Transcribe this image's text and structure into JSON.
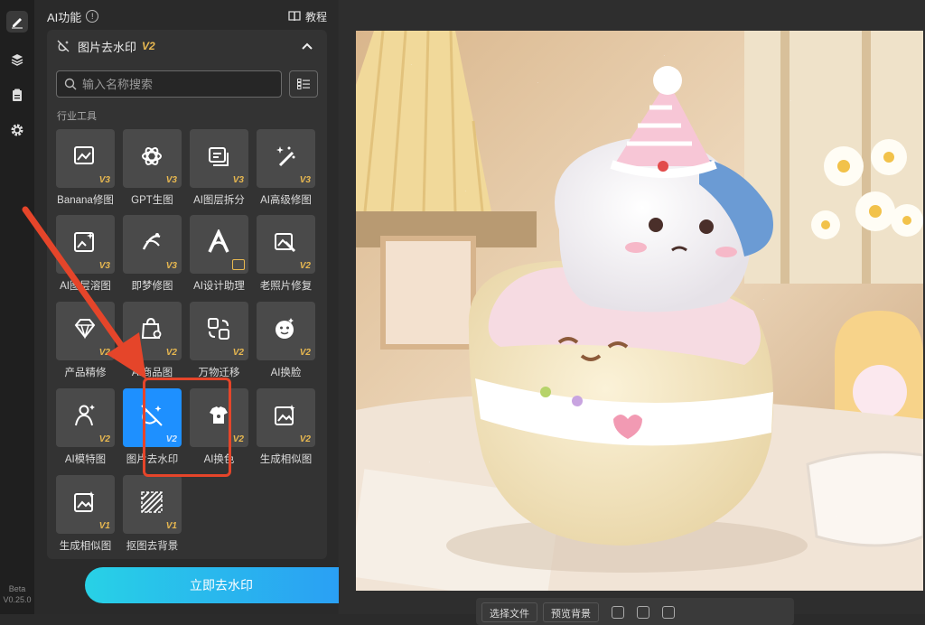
{
  "rail": {
    "items": [
      "edit-icon",
      "layers-icon",
      "clipboard-icon",
      "gear-icon"
    ],
    "version_tag": "Beta",
    "version": "V0.25.0"
  },
  "panel": {
    "title": "AI功能",
    "tutorial_label": "教程",
    "tool_title": "图片去水印",
    "tool_version": "V2",
    "search_placeholder": "输入名称搜索",
    "section_label": "行业工具",
    "tools": [
      {
        "label": "Banana修图",
        "ver": "V3",
        "icon": "image-edit-icon"
      },
      {
        "label": "GPT生图",
        "ver": "V3",
        "icon": "gpt-icon"
      },
      {
        "label": "AI图层拆分",
        "ver": "V3",
        "icon": "layer-split-icon"
      },
      {
        "label": "AI高级修图",
        "ver": "V3",
        "icon": "magic-wand-icon"
      },
      {
        "label": "AI图层溶图",
        "ver": "V3",
        "icon": "image-blend-icon"
      },
      {
        "label": "即梦修图",
        "ver": "V3",
        "icon": "jimeng-icon"
      },
      {
        "label": "AI设计助理",
        "ver": "",
        "icon": "design-assistant-icon",
        "badge": "crown"
      },
      {
        "label": "老照片修复",
        "ver": "V2",
        "icon": "photo-repair-icon"
      },
      {
        "label": "产品精修",
        "ver": "V2",
        "icon": "diamond-icon"
      },
      {
        "label": "AI商品图",
        "ver": "V2",
        "icon": "shopping-bag-icon"
      },
      {
        "label": "万物迁移",
        "ver": "V2",
        "icon": "transfer-icon"
      },
      {
        "label": "AI换脸",
        "ver": "V2",
        "icon": "face-swap-icon"
      },
      {
        "label": "AI模特图",
        "ver": "V2",
        "icon": "model-icon"
      },
      {
        "label": "图片去水印",
        "ver": "V2",
        "icon": "watermark-remove-icon",
        "selected": true
      },
      {
        "label": "AI换色",
        "ver": "V2",
        "icon": "recolor-icon"
      },
      {
        "label": "生成相似图",
        "ver": "V2",
        "icon": "similar-image-icon"
      },
      {
        "label": "生成相似图",
        "ver": "V1",
        "icon": "similar-image-icon"
      },
      {
        "label": "抠图去背景",
        "ver": "V1",
        "icon": "cutout-icon"
      }
    ],
    "cta_label": "立即去水印"
  },
  "toolbar": {
    "choose_file": "选择文件",
    "preview_bg": "预览背景"
  },
  "colors": {
    "accent": "#1e90ff",
    "version_badge": "#e8b850",
    "highlight": "#e5452a",
    "cta_start": "#28d1e6",
    "cta_end": "#2a9cf5"
  }
}
